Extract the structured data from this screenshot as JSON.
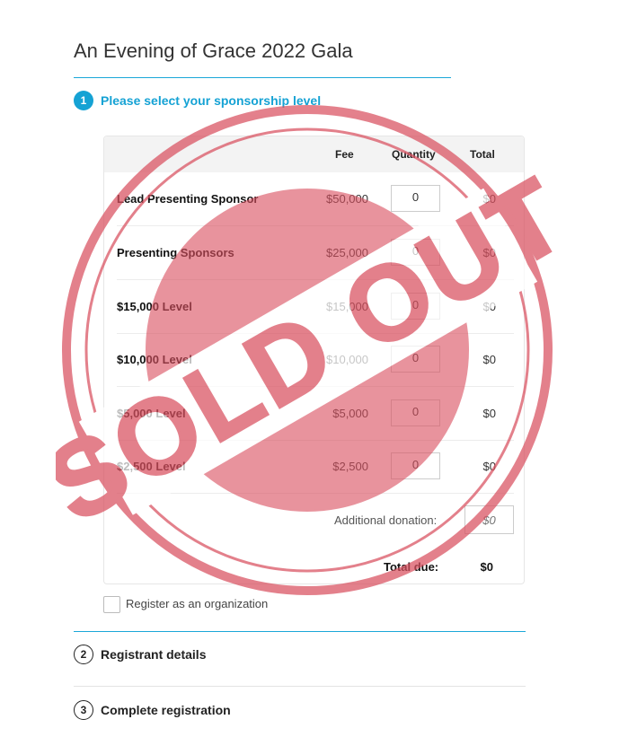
{
  "page": {
    "title": "An Evening of Grace 2022 Gala"
  },
  "steps": [
    {
      "number": "1",
      "label": "Please select your sponsorship level"
    },
    {
      "number": "2",
      "label": "Registrant details"
    },
    {
      "number": "3",
      "label": "Complete registration"
    }
  ],
  "table": {
    "headers": {
      "fee": "Fee",
      "quantity": "Quantity",
      "total": "Total"
    },
    "rows": [
      {
        "name": "Lead Presenting Sponsor",
        "fee": "$50,000",
        "quantity": "0",
        "total": "$0"
      },
      {
        "name": "Presenting Sponsors",
        "fee": "$25,000",
        "quantity": "0",
        "total": "$0"
      },
      {
        "name": "$15,000 Level",
        "fee": "$15,000",
        "quantity": "0",
        "total": "$0"
      },
      {
        "name": "$10,000 Level",
        "fee": "$10,000",
        "quantity": "0",
        "total": "$0"
      },
      {
        "name": "$5,000 Level",
        "fee": "$5,000",
        "quantity": "0",
        "total": "$0"
      },
      {
        "name": "$2,500 Level",
        "fee": "$2,500",
        "quantity": "0",
        "total": "$0"
      }
    ],
    "donation": {
      "label": "Additional donation:",
      "placeholder": "$0"
    },
    "total_due": {
      "label": "Total due:",
      "value": "$0"
    }
  },
  "organization_checkbox": {
    "label": "Register as an organization",
    "checked": false
  },
  "stamp": {
    "text": "SOLD OUT",
    "color": "#d9505f"
  },
  "colors": {
    "accent": "#15a2d4"
  }
}
